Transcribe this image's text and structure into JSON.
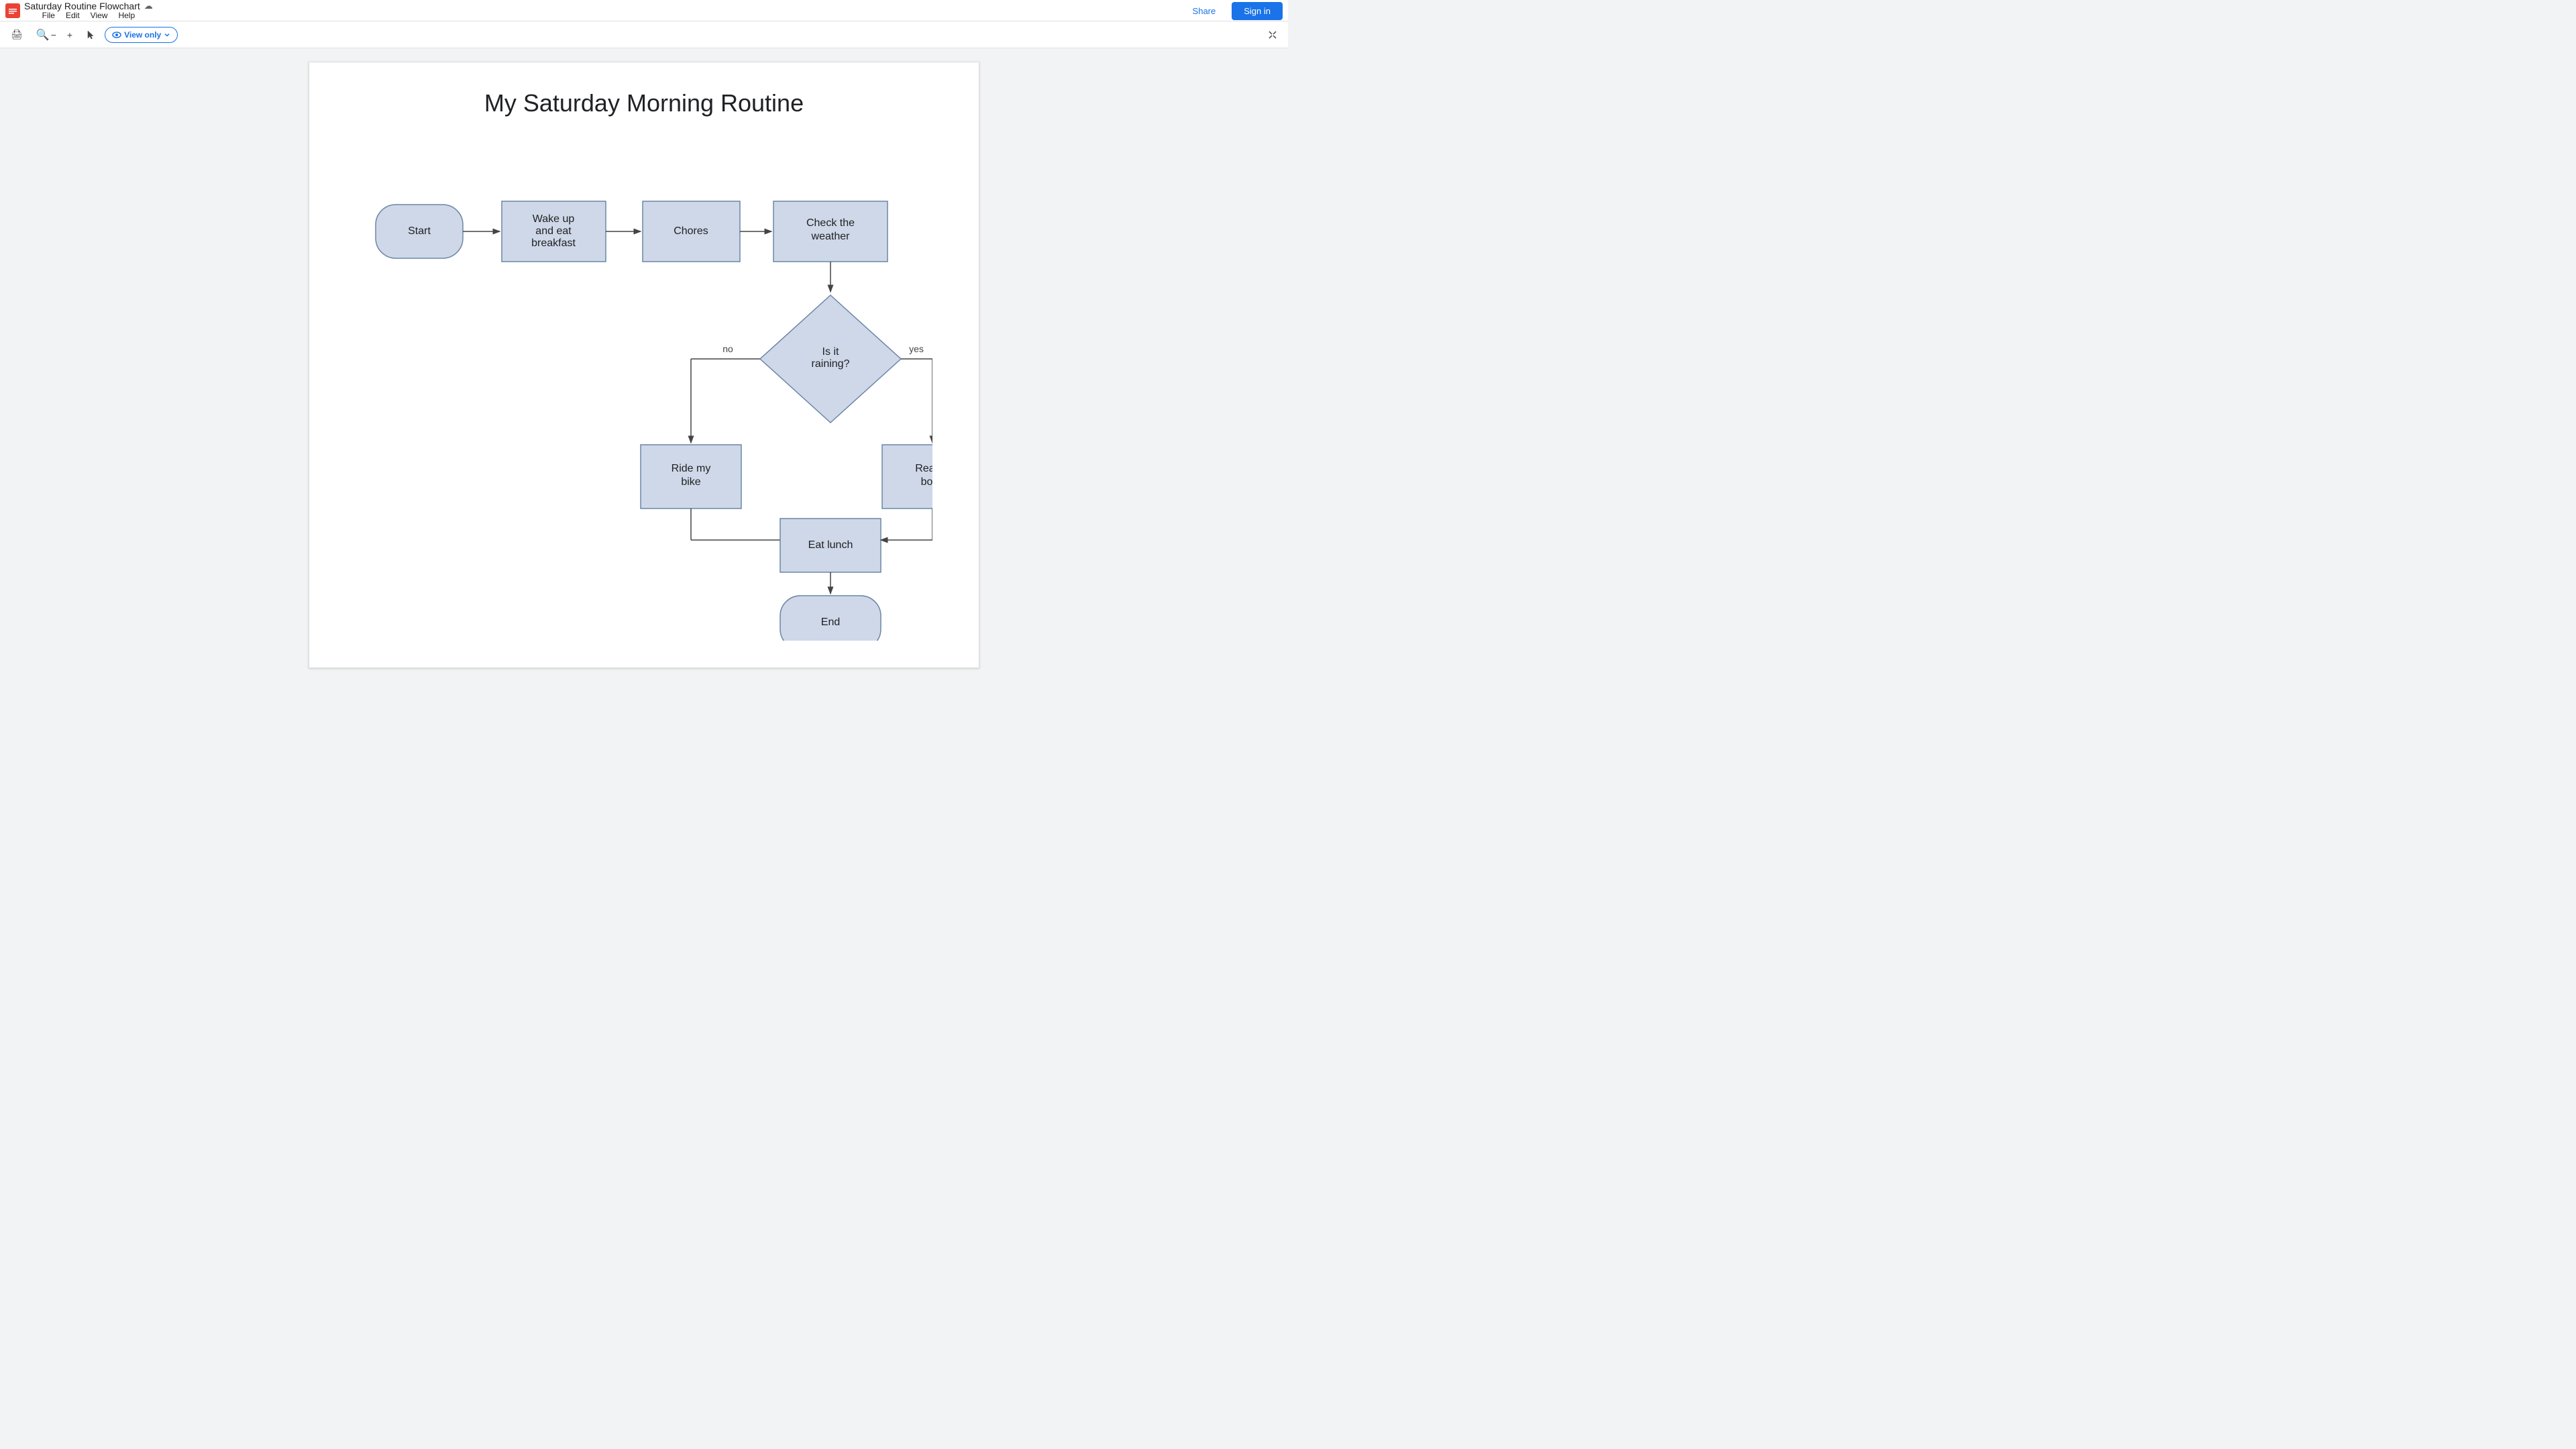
{
  "topbar": {
    "app_icon_color": "#ea4335",
    "doc_title": "Saturday Routine Flowchart",
    "cloud_icon": "☁",
    "menu_items": [
      "File",
      "Edit",
      "View",
      "Help"
    ],
    "share_label": "Share",
    "signin_label": "Sign in"
  },
  "toolbar": {
    "print_icon": "🖨",
    "zoom_out_icon": "−",
    "zoom_in_icon": "+",
    "pointer_icon": "↖",
    "view_only_icon": "👁",
    "view_only_label": "View only",
    "expand_icon": "⤢"
  },
  "flowchart": {
    "title": "My Saturday Morning Routine",
    "nodes": {
      "start": "Start",
      "wake_up": "Wake up and eat breakfast",
      "chores": "Chores",
      "check_weather": "Check the weather",
      "is_raining": "Is it raining?",
      "no_label": "no",
      "yes_label": "yes",
      "ride_bike": "Ride my bike",
      "read_book": "Read a book",
      "eat_lunch": "Eat lunch",
      "end": "End"
    }
  }
}
